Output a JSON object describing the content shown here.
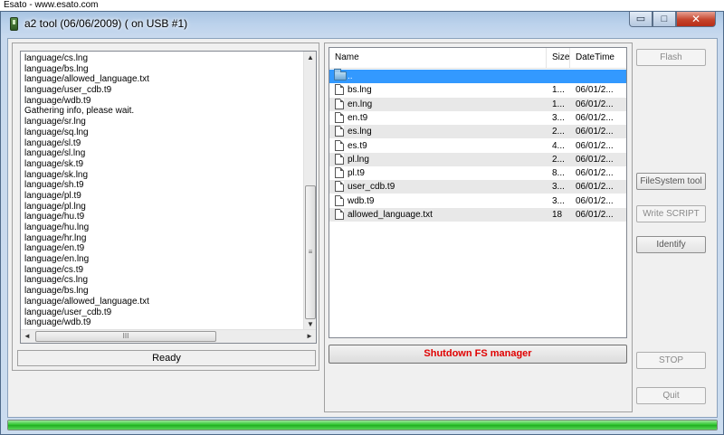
{
  "banner": {
    "text": "Esato - www.esato.com"
  },
  "window": {
    "title": "a2 tool (06/06/2009) ( on USB #1)",
    "controls": {
      "minimize": "▭",
      "maximize": "□",
      "close": "✕"
    }
  },
  "log": {
    "lines": [
      "language/cs.lng",
      "language/bs.lng",
      "language/allowed_language.txt",
      "language/user_cdb.t9",
      "language/wdb.t9",
      "Gathering info, please wait.",
      "language/sr.lng",
      "language/sq.lng",
      "language/sl.t9",
      "language/sl.lng",
      "language/sk.t9",
      "language/sk.lng",
      "language/sh.t9",
      "language/pl.t9",
      "language/pl.lng",
      "language/hu.t9",
      "language/hu.lng",
      "language/hr.lng",
      "language/en.t9",
      "language/en.lng",
      "language/cs.t9",
      "language/cs.lng",
      "language/bs.lng",
      "language/allowed_language.txt",
      "language/user_cdb.t9",
      "language/wdb.t9"
    ],
    "scroll": {
      "up": "▲",
      "down": "▼",
      "left": "◄",
      "right": "►",
      "grip_v": "≡",
      "grip_h": "III"
    }
  },
  "status": {
    "text": "Ready"
  },
  "file_manager": {
    "columns": [
      "Name",
      "Size",
      "DateTime"
    ],
    "rows": [
      {
        "name": "..",
        "size": "",
        "date": "",
        "type": "folder"
      },
      {
        "name": "bs.lng",
        "size": "1...",
        "date": "06/01/2...",
        "type": "file"
      },
      {
        "name": "en.lng",
        "size": "1...",
        "date": "06/01/2...",
        "type": "file"
      },
      {
        "name": "en.t9",
        "size": "3...",
        "date": "06/01/2...",
        "type": "file"
      },
      {
        "name": "es.lng",
        "size": "2...",
        "date": "06/01/2...",
        "type": "file"
      },
      {
        "name": "es.t9",
        "size": "4...",
        "date": "06/01/2...",
        "type": "file"
      },
      {
        "name": "pl.lng",
        "size": "2...",
        "date": "06/01/2...",
        "type": "file"
      },
      {
        "name": "pl.t9",
        "size": "8...",
        "date": "06/01/2...",
        "type": "file"
      },
      {
        "name": "user_cdb.t9",
        "size": "3...",
        "date": "06/01/2...",
        "type": "file"
      },
      {
        "name": "wdb.t9",
        "size": "3...",
        "date": "06/01/2...",
        "type": "file"
      },
      {
        "name": "allowed_language.txt",
        "size": "18",
        "date": "06/01/2...",
        "type": "file"
      }
    ],
    "shutdown_label": "Shutdown FS manager"
  },
  "buttons": {
    "flash": "Flash",
    "filesystem": "FileSystem tool",
    "write_script": "Write SCRIPT",
    "identify": "Identify",
    "stop": "STOP",
    "quit": "Quit"
  },
  "progress": {
    "value": 1.0,
    "color": "#27c227"
  }
}
